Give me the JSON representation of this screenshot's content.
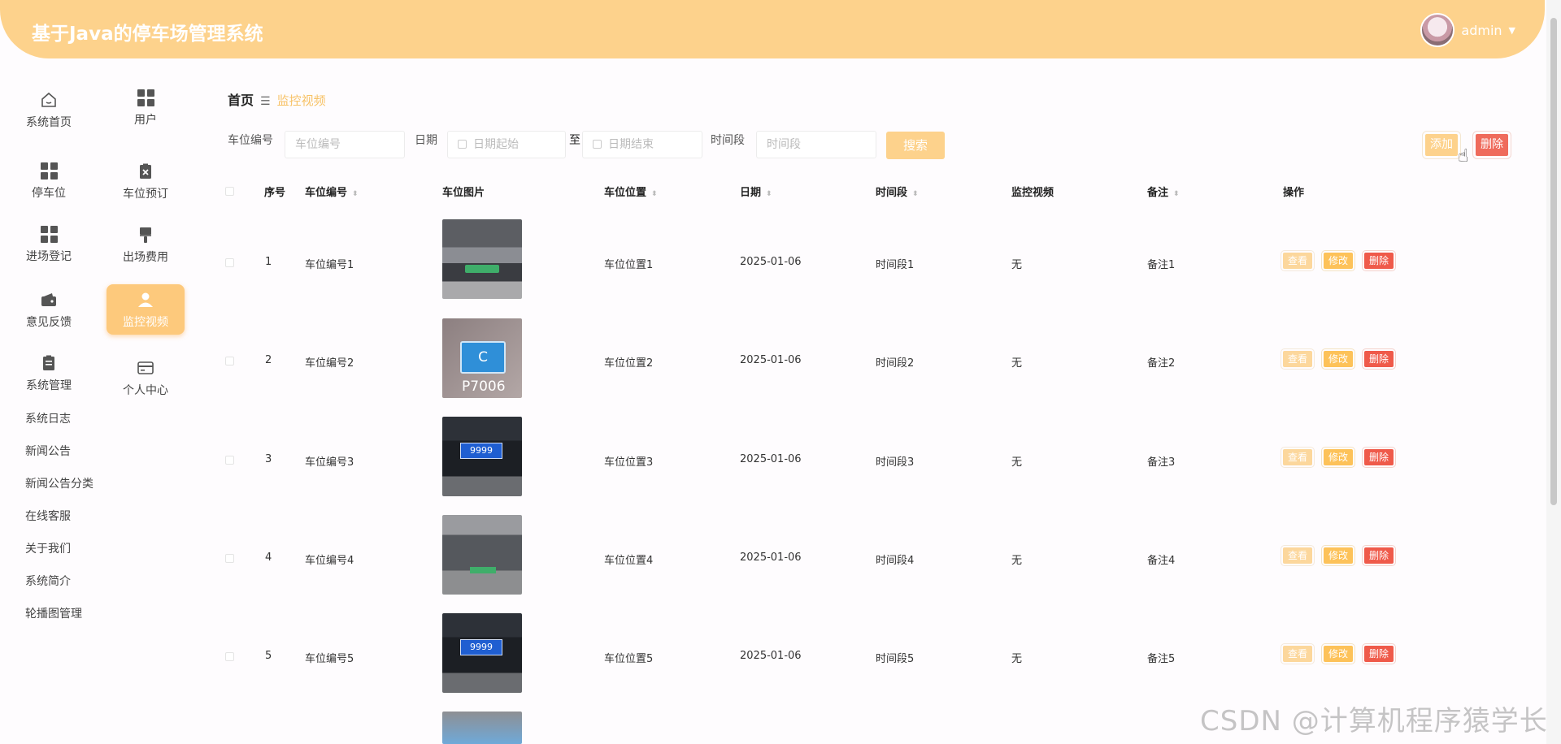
{
  "app": {
    "title": "基于Java的停车场管理系统",
    "username": "admin"
  },
  "nav_col1": [
    {
      "label": "系统首页",
      "icon": "home-icon"
    },
    {
      "label": "停车位",
      "icon": "grid-icon"
    },
    {
      "label": "进场登记",
      "icon": "grid-icon"
    },
    {
      "label": "意见反馈",
      "icon": "wallet-icon"
    },
    {
      "label": "系统管理",
      "icon": "clipboard-icon"
    }
  ],
  "nav_col2": [
    {
      "label": "用户",
      "icon": "grid-icon"
    },
    {
      "label": "车位预订",
      "icon": "clipboard-x-icon"
    },
    {
      "label": "出场费用",
      "icon": "brush-icon"
    },
    {
      "label": "监控视频",
      "icon": "user-icon",
      "active": true
    },
    {
      "label": "个人中心",
      "icon": "card-icon"
    }
  ],
  "sub_menu": [
    "系统日志",
    "新闻公告",
    "新闻公告分类",
    "在线客服",
    "关于我们",
    "系统简介",
    "轮播图管理"
  ],
  "breadcrumb": {
    "home": "首页",
    "separator": "☰",
    "current": "监控视频"
  },
  "filters": {
    "slot_label": "车位编号",
    "slot_placeholder": "车位编号",
    "date_label": "日期",
    "date_start_placeholder": "日期起始",
    "date_to": "至",
    "date_end_placeholder": "日期结束",
    "period_label": "时间段",
    "period_placeholder": "时间段",
    "search": "搜索"
  },
  "actions": {
    "add": "添加",
    "delete": "删除"
  },
  "table": {
    "headers": [
      "序号",
      "车位编号",
      "车位图片",
      "车位位置",
      "日期",
      "时间段",
      "监控视频",
      "备注",
      "操作"
    ],
    "rows": [
      {
        "no": "1",
        "slot": "车位编号1",
        "location": "车位位置1",
        "date": "2025-01-06",
        "period": "时间段1",
        "video": "无",
        "note": "备注1"
      },
      {
        "no": "2",
        "slot": "车位编号2",
        "location": "车位位置2",
        "date": "2025-01-06",
        "period": "时间段2",
        "video": "无",
        "note": "备注2"
      },
      {
        "no": "3",
        "slot": "车位编号3",
        "location": "车位位置3",
        "date": "2025-01-06",
        "period": "时间段3",
        "video": "无",
        "note": "备注3"
      },
      {
        "no": "4",
        "slot": "车位编号4",
        "location": "车位位置4",
        "date": "2025-01-06",
        "period": "时间段4",
        "video": "无",
        "note": "备注4"
      },
      {
        "no": "5",
        "slot": "车位编号5",
        "location": "车位位置5",
        "date": "2025-01-06",
        "period": "时间段5",
        "video": "无",
        "note": "备注5"
      }
    ],
    "row_ops": {
      "view": "查看",
      "edit": "修改",
      "delete": "删除"
    }
  },
  "watermark": "CSDN @计算机程序猿学长",
  "colors": {
    "header": "#fdd28c",
    "accent": "#f7c266",
    "danger": "#ef5a4a",
    "edit": "#fdc259"
  }
}
